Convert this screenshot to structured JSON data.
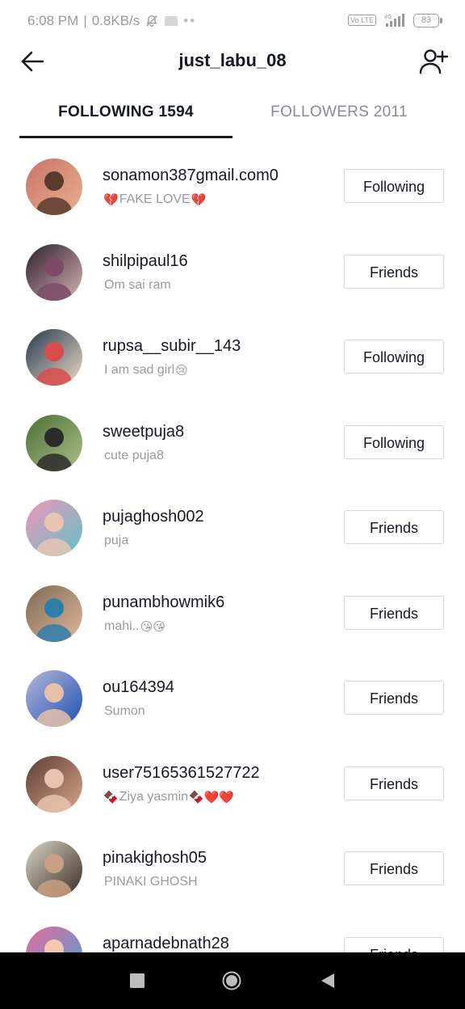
{
  "status_bar": {
    "time": "6:08 PM",
    "network_speed": "0.8KB/s",
    "separator": "|",
    "icons": [
      "mute-icon",
      "message-icon",
      "volte-icon",
      "signal-icon"
    ],
    "volte_label": "Vo LTE",
    "signal_label": "4G",
    "battery": "83"
  },
  "header": {
    "title": "just_labu_08",
    "back_icon": "arrow-left-icon",
    "add_icon": "add-user-icon"
  },
  "tabs": [
    {
      "label": "FOLLOWING 1594",
      "active": true
    },
    {
      "label": "FOLLOWERS 2011",
      "active": false
    }
  ],
  "users": [
    {
      "username": "sonamon387gmail.com0",
      "bio": "FAKE LOVE",
      "bio_prefix": "💔",
      "bio_suffix": "💔",
      "button": "Following",
      "avatar_colors": [
        "#c9736a",
        "#e8b08e",
        "#5a3a2e"
      ]
    },
    {
      "username": "shilpipaul16",
      "bio": "Om sai ram",
      "bio_prefix": "",
      "bio_suffix": "",
      "button": "Friends",
      "avatar_colors": [
        "#2a1f2b",
        "#d9b2b6",
        "#7d4a66"
      ]
    },
    {
      "username": "rupsa__subir__143",
      "bio": "I am sad girl",
      "bio_prefix": "",
      "bio_suffix": "😢",
      "button": "Following",
      "avatar_colors": [
        "#233a4e",
        "#f1d9c7",
        "#d84c4c"
      ]
    },
    {
      "username": "sweetpuja8",
      "bio": "cute puja8",
      "bio_prefix": "",
      "bio_suffix": "",
      "button": "Following",
      "avatar_colors": [
        "#4e6f34",
        "#a8bf8a",
        "#2b2b2b"
      ]
    },
    {
      "username": "pujaghosh002",
      "bio": "puja",
      "bio_prefix": "",
      "bio_suffix": "",
      "button": "Friends",
      "avatar_colors": [
        "#f097b8",
        "#5fc1c7",
        "#e7c5b3"
      ]
    },
    {
      "username": "punambhowmik6",
      "bio": "mahi..",
      "bio_prefix": "",
      "bio_suffix": "😘😘",
      "button": "Friends",
      "avatar_colors": [
        "#7d6a55",
        "#e2b79c",
        "#2d7ea8"
      ]
    },
    {
      "username": "ou164394",
      "bio": "Sumon",
      "bio_prefix": "",
      "bio_suffix": "",
      "button": "Friends",
      "avatar_colors": [
        "#b5b8d8",
        "#1d4fb3",
        "#e6c1a8"
      ]
    },
    {
      "username": "user75165361527722",
      "bio": "Ziya yasmin",
      "bio_prefix": "🍫",
      "bio_suffix": "🍫❤️❤️",
      "button": "Friends",
      "avatar_colors": [
        "#5b3d33",
        "#d9a58a",
        "#e8c4b0"
      ]
    },
    {
      "username": "pinakighosh05",
      "bio": "PINAKI GHOSH",
      "bio_prefix": "",
      "bio_suffix": "",
      "button": "Friends",
      "avatar_colors": [
        "#d8d4c6",
        "#3b2b20",
        "#c9a083"
      ]
    },
    {
      "username": "aparnadebnath28",
      "bio": "",
      "bio_prefix": "",
      "bio_suffix": "",
      "button": "Friends",
      "avatar_colors": [
        "#e56a9b",
        "#4aa3d8",
        "#f3c9b2"
      ]
    }
  ],
  "nav_bar": {
    "icons": [
      "recents-icon",
      "home-icon",
      "back-icon"
    ]
  }
}
